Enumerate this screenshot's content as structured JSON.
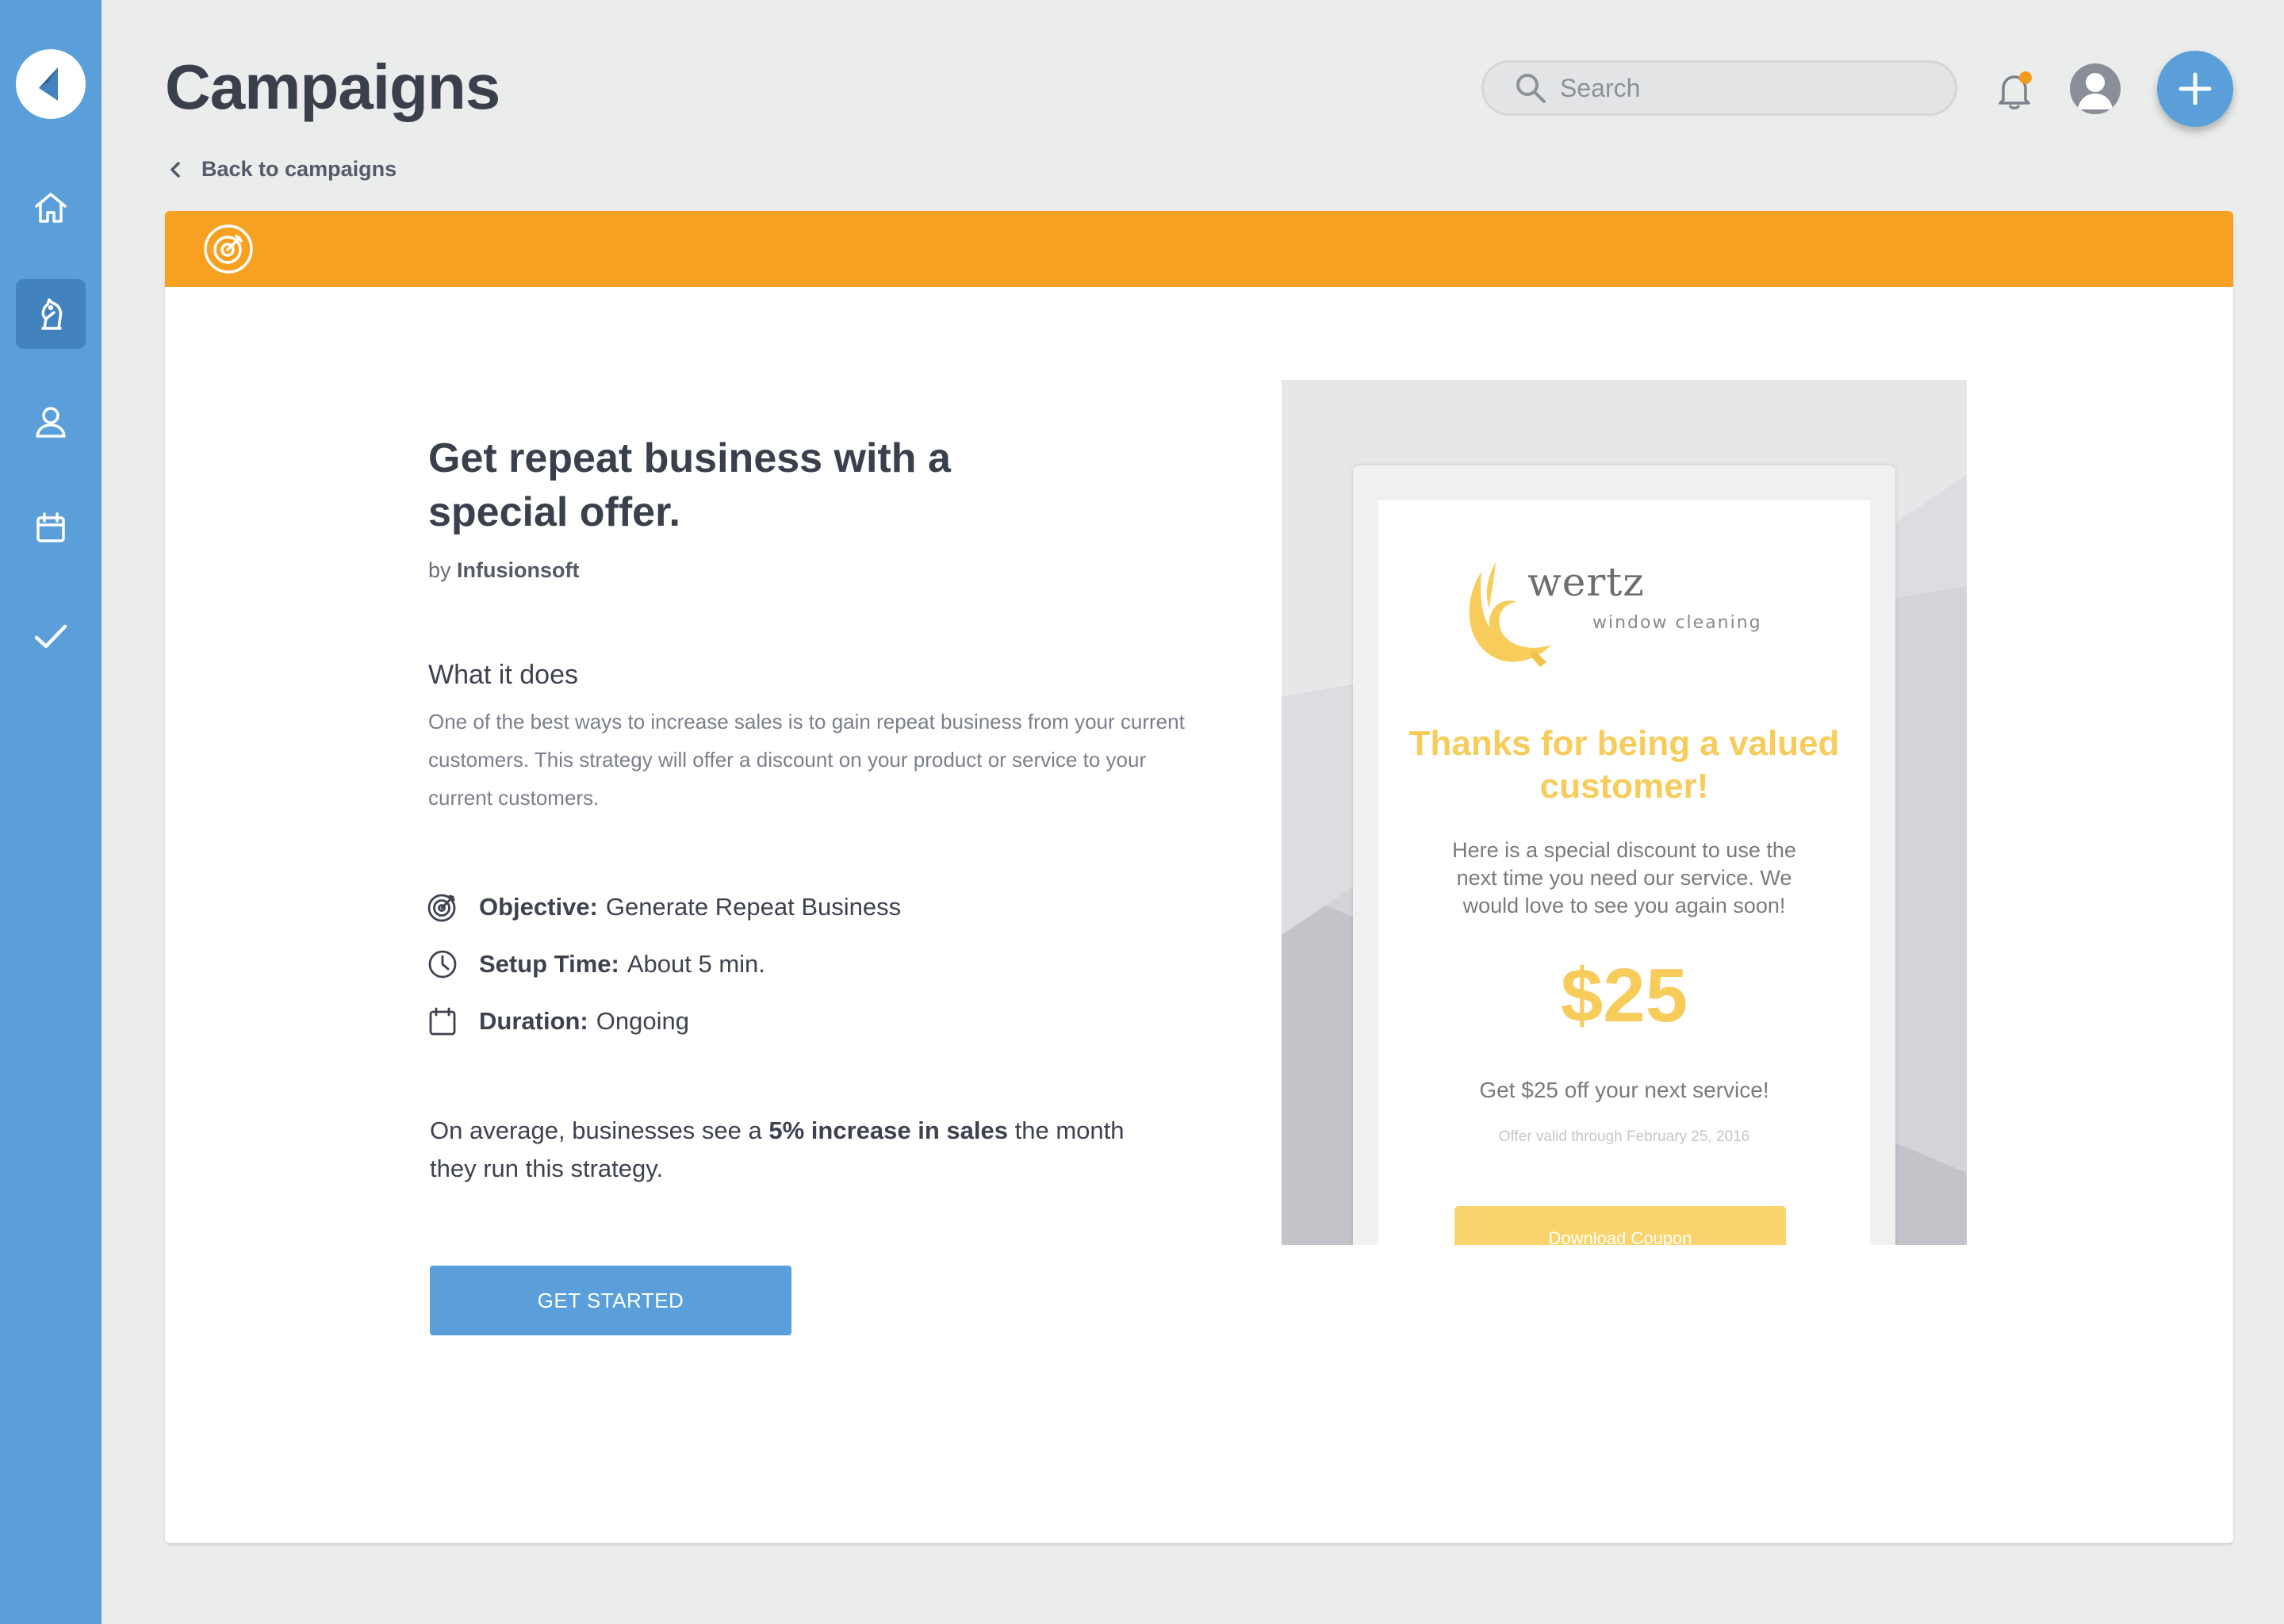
{
  "header": {
    "title": "Campaigns",
    "back_label": "Back to campaigns"
  },
  "search": {
    "placeholder": "Search"
  },
  "sidebar": {
    "items": [
      {
        "icon": "home-icon",
        "active": false
      },
      {
        "icon": "chess-knight-icon",
        "active": true
      },
      {
        "icon": "contact-icon",
        "active": false
      },
      {
        "icon": "calendar-icon",
        "active": false
      },
      {
        "icon": "checkmark-icon",
        "active": false
      }
    ]
  },
  "campaign": {
    "headline": "Get repeat business with a special offer.",
    "by_prefix": "by",
    "author": "Infusionsoft",
    "section_title": "What it does",
    "description": "One of the best ways to increase sales is to gain repeat business from your current customers. This strategy will offer a discount on your product or service to your current customers.",
    "meta": {
      "objective_label": "Objective:",
      "objective_value": "Generate Repeat Business",
      "setup_label": "Setup Time:",
      "setup_value": "About 5 min.",
      "duration_label": "Duration:",
      "duration_value": "Ongoing"
    },
    "avg_pre": "On average, businesses see a",
    "avg_bold": "5% increase in sales",
    "avg_post": "the month they run this strategy.",
    "cta_label": "GET STARTED"
  },
  "preview": {
    "brand_name": "wertz",
    "brand_sub": "window cleaning",
    "thanks": "Thanks for being a valued customer!",
    "offer_text": "Here is a special discount to use the next time you need our service. We would love to see you again soon!",
    "amount": "$25",
    "get_off": "Get $25 off your next service!",
    "valid": "Offer valid through February 25, 2016",
    "coupon_label": "Download Coupon"
  },
  "colors": {
    "sidebar": "#5a9fd9",
    "accent_band": "#f7a123",
    "primary_button": "#5a9fd9",
    "notification_dot": "#f29a1c",
    "brand_yellow": "#f7cc5b"
  }
}
